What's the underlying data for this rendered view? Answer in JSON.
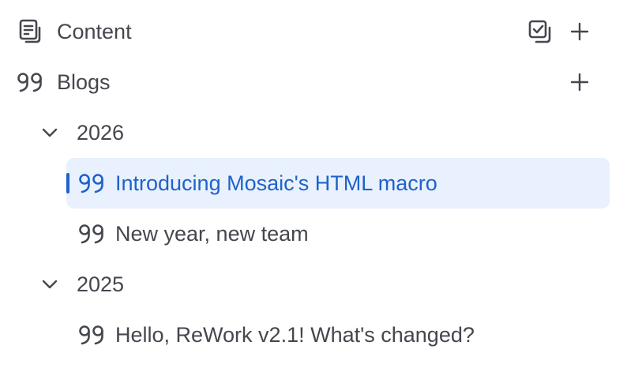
{
  "sections": {
    "content": {
      "label": "Content",
      "icon": "document-lines-icon",
      "actions": [
        "stacked-checkbox-icon",
        "plus-icon"
      ]
    },
    "blogs": {
      "label": "Blogs",
      "icon": "quote-icon",
      "actions": [
        "plus-icon"
      ]
    }
  },
  "years": [
    {
      "label": "2026",
      "expanded": true,
      "posts": [
        {
          "title": "Introducing Mosaic's HTML macro",
          "selected": true
        },
        {
          "title": "New year, new team",
          "selected": false
        }
      ]
    },
    {
      "label": "2025",
      "expanded": true,
      "posts": [
        {
          "title": "Hello, ReWork v2.1! What's changed?",
          "selected": false
        }
      ]
    }
  ],
  "colors": {
    "text": "#44474d",
    "accent": "#1f62c9",
    "selected_background": "#e8f1fd"
  }
}
